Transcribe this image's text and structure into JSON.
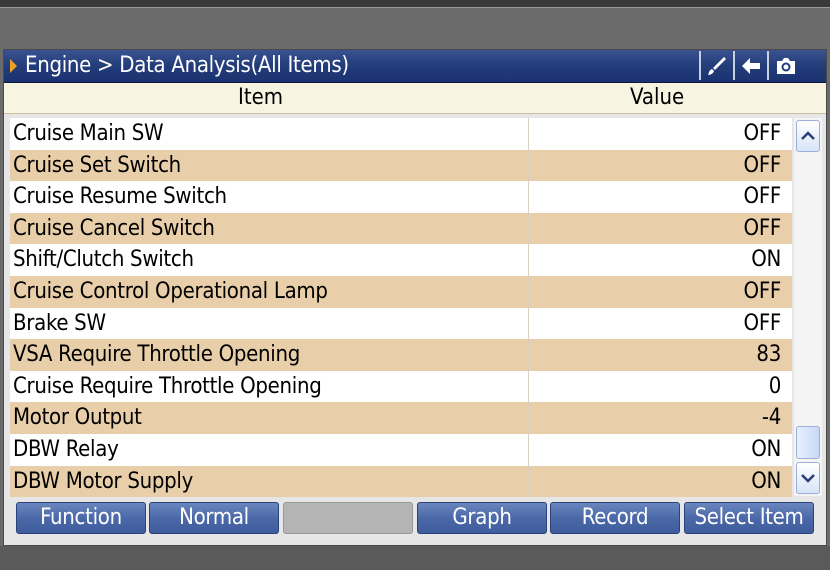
{
  "window": {
    "title": "Engine > Data Analysis(All Items)",
    "toolbar_icons": [
      "brush-icon",
      "back-arrow-icon",
      "camera-icon"
    ]
  },
  "table": {
    "header_item": "Item",
    "header_value": "Value",
    "rows": [
      {
        "item": "Cruise Main SW",
        "value": "OFF"
      },
      {
        "item": "Cruise Set Switch",
        "value": "OFF"
      },
      {
        "item": "Cruise Resume Switch",
        "value": "OFF"
      },
      {
        "item": "Cruise Cancel Switch",
        "value": "OFF"
      },
      {
        "item": "Shift/Clutch Switch",
        "value": "ON"
      },
      {
        "item": "Cruise Control Operational Lamp",
        "value": "OFF"
      },
      {
        "item": "Brake SW",
        "value": "OFF"
      },
      {
        "item": "VSA Require Throttle Opening",
        "value": "83"
      },
      {
        "item": "Cruise Require Throttle Opening",
        "value": "0"
      },
      {
        "item": "Motor Output",
        "value": "-4"
      },
      {
        "item": "DBW Relay",
        "value": "ON"
      },
      {
        "item": "DBW Motor Supply",
        "value": "ON"
      }
    ]
  },
  "footer": {
    "buttons": [
      {
        "label": "Function"
      },
      {
        "label": "Normal"
      },
      {
        "label": ""
      },
      {
        "label": "Graph"
      },
      {
        "label": "Record"
      },
      {
        "label": "Select Item"
      }
    ]
  },
  "colors": {
    "title_bar": "#233c7a",
    "row_alt": "#e8cfa9",
    "button": "#4b69a8"
  }
}
